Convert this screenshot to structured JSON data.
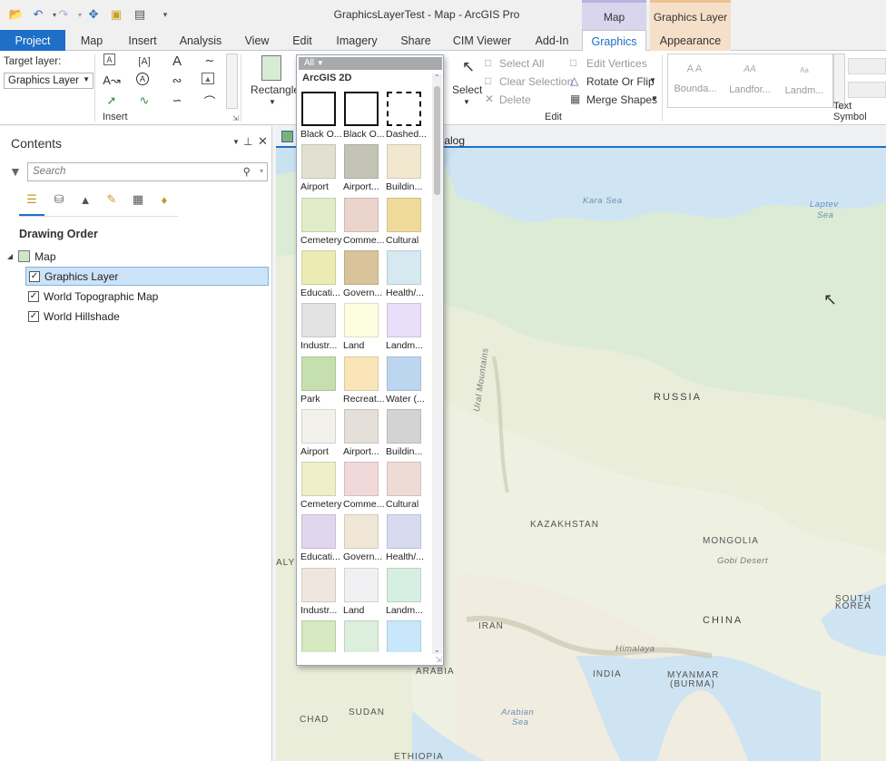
{
  "window": {
    "title": "GraphicsLayerTest - Map - ArcGIS Pro",
    "context_tabs": {
      "map": "Map",
      "graphics_layer": "Graphics Layer"
    }
  },
  "tabs": [
    "Project",
    "Map",
    "Insert",
    "Analysis",
    "View",
    "Edit",
    "Imagery",
    "Share",
    "CIM Viewer",
    "Add-In",
    "Graphics",
    "Appearance"
  ],
  "ribbon": {
    "target_layer_label": "Target layer:",
    "target_layer_value": "Graphics Layer",
    "insert_group": "Insert",
    "rectangle_label": "Rectangle",
    "select_label": "Select",
    "select_all": "Select All",
    "clear_selection": "Clear Selection",
    "delete": "Delete",
    "edit_vertices": "Edit Vertices",
    "rotate_flip": "Rotate Or Flip",
    "merge_shapes": "Merge Shapes",
    "edit_group": "Edit",
    "text_symbol_group": "Text Symbol",
    "text_symbols": [
      "Bounda...",
      "Landfor...",
      "Landm..."
    ]
  },
  "contents": {
    "title": "Contents",
    "search_placeholder": "Search",
    "drawing_order": "Drawing Order",
    "map_node": "Map",
    "layers": [
      "Graphics Layer",
      "World Topographic Map",
      "World Hillshade"
    ]
  },
  "map_view": {
    "tab_label_partial": "talog",
    "labels": {
      "kara_sea": "Kara Sea",
      "laptev_sea_1": "Laptev",
      "laptev_sea_2": "Sea",
      "russia": "RUSSIA",
      "ural": "Ural Mountains",
      "kazakhstan": "KAZAKHSTAN",
      "mongolia": "MONGOLIA",
      "gobi": "Gobi Desert",
      "china": "CHINA",
      "south_korea_1": "SOUTH",
      "south_korea_2": "KOREA",
      "iran": "IRAN",
      "himalaya": "Himalaya",
      "india": "INDIA",
      "myanmar_1": "MYANMAR",
      "myanmar_2": "(BURMA)",
      "arabia": "ARABIA",
      "sudan": "SUDAN",
      "chad": "CHAD",
      "arabian_sea_1": "Arabian",
      "arabian_sea_2": "Sea",
      "ethiopia": "ETHIOPIA",
      "aly": "ALY"
    }
  },
  "gallery": {
    "filter": "All",
    "heading": "ArcGIS 2D",
    "swatches": [
      {
        "label": "Black O...",
        "color": "#ffffff",
        "outline": "solid"
      },
      {
        "label": "Black O...",
        "color": "#ffffff",
        "outline": "solid"
      },
      {
        "label": "Dashed...",
        "color": "#ffffff",
        "outline": "dashed"
      },
      {
        "label": "Airport",
        "color": "#e2e0d0"
      },
      {
        "label": "Airport...",
        "color": "#c4c4b6"
      },
      {
        "label": "Buildin...",
        "color": "#f1e8cf"
      },
      {
        "label": "Cemetery",
        "color": "#e2ecc8"
      },
      {
        "label": "Comme...",
        "color": "#ead4cc"
      },
      {
        "label": "Cultural",
        "color": "#f1db9c"
      },
      {
        "label": "Educati...",
        "color": "#ecebb3"
      },
      {
        "label": "Govern...",
        "color": "#d8c39b"
      },
      {
        "label": "Health/...",
        "color": "#d6e8f0"
      },
      {
        "label": "Industr...",
        "color": "#e3e3e3"
      },
      {
        "label": "Land",
        "color": "#fdfde0"
      },
      {
        "label": "Landm...",
        "color": "#e8defa"
      },
      {
        "label": "Park",
        "color": "#c5dfae"
      },
      {
        "label": "Recreat...",
        "color": "#f9e5b8"
      },
      {
        "label": "Water (...",
        "color": "#bcd6f0"
      },
      {
        "label": "Airport",
        "color": "#f3f1ec"
      },
      {
        "label": "Airport...",
        "color": "#e4dfd8"
      },
      {
        "label": "Buildin...",
        "color": "#d3d3d3"
      },
      {
        "label": "Cemetery",
        "color": "#eeeec8"
      },
      {
        "label": "Comme...",
        "color": "#f1d9d9"
      },
      {
        "label": "Cultural",
        "color": "#efdbd6"
      },
      {
        "label": "Educati...",
        "color": "#e2d6ef"
      },
      {
        "label": "Govern...",
        "color": "#efe6d6"
      },
      {
        "label": "Health/...",
        "color": "#d8daf0"
      },
      {
        "label": "Industr...",
        "color": "#efe6df"
      },
      {
        "label": "Land",
        "color": "#f1f1f3"
      },
      {
        "label": "Landm...",
        "color": "#d7eee3"
      },
      {
        "label": "",
        "color": "#d6e8c0"
      },
      {
        "label": "",
        "color": "#dcefdc"
      },
      {
        "label": "",
        "color": "#c9e7fb"
      }
    ]
  }
}
